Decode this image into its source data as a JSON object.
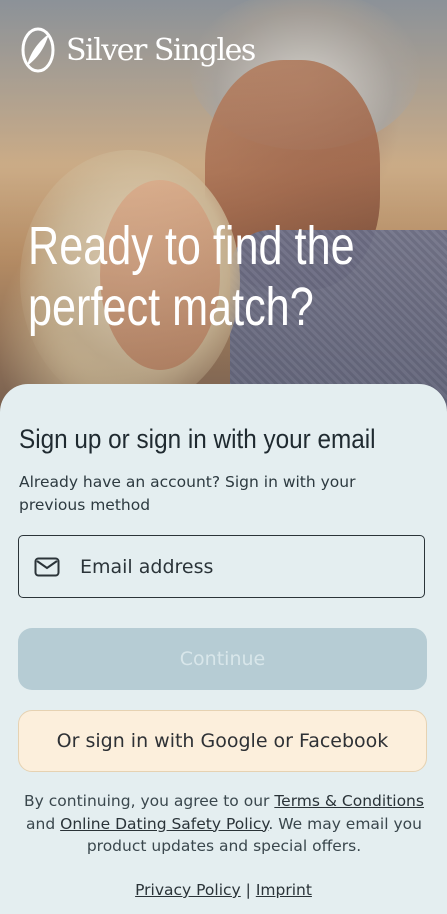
{
  "brand": {
    "name": "Silver Singles",
    "logo_icon": "leaf-logo-icon"
  },
  "hero": {
    "headline_line1": "Ready to find the",
    "headline_line2": "perfect match?"
  },
  "sheet": {
    "title": "Sign up or sign in with your email",
    "subtitle": "Already have an account? Sign in with your previous method",
    "email_placeholder": "Email address",
    "email_icon": "envelope-icon",
    "continue_label": "Continue",
    "social_label": "Or sign in with Google or Facebook"
  },
  "legal": {
    "prefix": "By continuing, you agree to our ",
    "terms": "Terms & Conditions",
    "and": " and ",
    "safety": "Online Dating Safety Policy",
    "suffix": ". We may email you product updates and special offers.",
    "privacy": "Privacy Policy",
    "separator": " | ",
    "imprint": "Imprint"
  },
  "colors": {
    "sheet_bg": "#e4eef0",
    "continue_bg": "#b6ccd4",
    "social_bg": "#fcefdc"
  }
}
